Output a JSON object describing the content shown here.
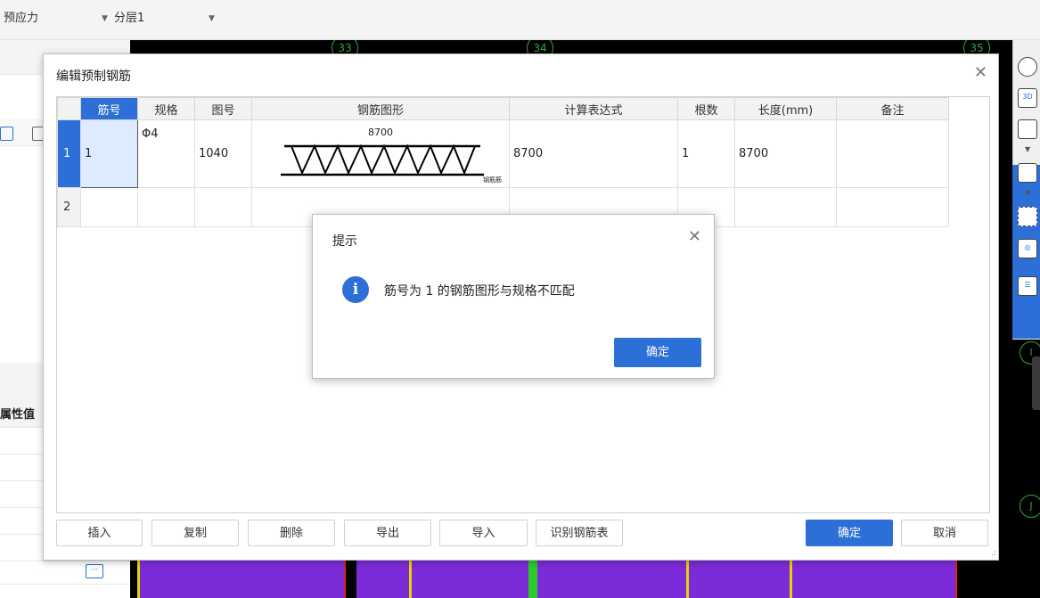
{
  "toolbar": {
    "type_select": "预应力",
    "layer_select": "分层1"
  },
  "left_panel": {
    "property_value_header": "属性值"
  },
  "canvas": {
    "grid_labels": [
      "33",
      "34",
      "35"
    ],
    "edge_labels": [
      "I",
      "J"
    ]
  },
  "dialog": {
    "title": "编辑预制钢筋",
    "columns": [
      "筋号",
      "规格",
      "图号",
      "钢筋图形",
      "计算表达式",
      "根数",
      "长度(mm)",
      "备注"
    ],
    "rows": [
      {
        "row_num": "1",
        "bar_no": "1",
        "spec": "Φ4",
        "figure_no": "1040",
        "figure_dimension": "8700",
        "figure_tag": "钢筋筋",
        "expression": "8700",
        "count": "1",
        "length": "8700",
        "note": ""
      },
      {
        "row_num": "2",
        "bar_no": "",
        "spec": "",
        "figure_no": "",
        "figure_dimension": "",
        "figure_tag": "",
        "expression": "",
        "count": "",
        "length": "",
        "note": ""
      }
    ],
    "buttons": {
      "insert": "插入",
      "copy": "复制",
      "delete": "删除",
      "export": "导出",
      "import": "导入",
      "recognize": "识别钢筋表",
      "ok": "确定",
      "cancel": "取消"
    }
  },
  "prompt": {
    "title": "提示",
    "info_glyph": "i",
    "message": "筋号为 1 的钢筋图形与规格不匹配",
    "ok": "确定"
  },
  "colors": {
    "accent": "#2c6fd6",
    "canvas_bg": "#000000",
    "slab_purple": "#7c2bd8",
    "grid_green": "#2eaa3a"
  }
}
